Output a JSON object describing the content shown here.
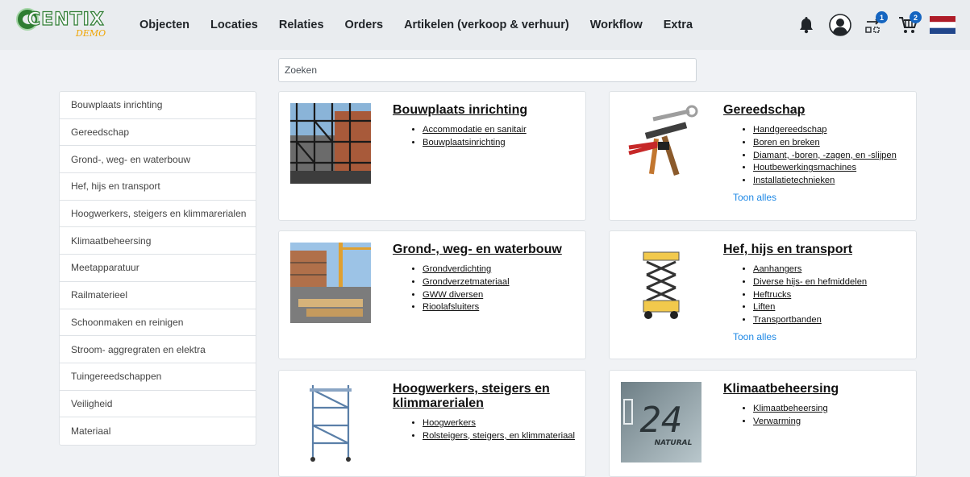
{
  "header": {
    "logo_text": "CENTIX",
    "logo_sub": "DEMO",
    "nav": [
      "Objecten",
      "Locaties",
      "Relaties",
      "Orders",
      "Artikelen (verkoop & verhuur)",
      "Workflow",
      "Extra"
    ],
    "icons": [
      "bell-icon",
      "user-avatar-icon",
      "transfer-icon",
      "cart-icon",
      "dutch-flag-icon"
    ],
    "transfer_count": "1",
    "cart_count": "2"
  },
  "search": {
    "placeholder": "Zoeken",
    "value": ""
  },
  "sidebar": {
    "items": [
      "Bouwplaats inrichting",
      "Gereedschap",
      "Grond-, weg- en waterbouw",
      "Hef, hijs en transport",
      "Hoogwerkers, steigers en klimmarerialen",
      "Klimaatbeheersing",
      "Meetapparatuur",
      "Railmaterieel",
      "Schoonmaken en reinigen",
      "Stroom- aggregraten en elektra",
      "Tuingereedschappen",
      "Veiligheid",
      "Materiaal"
    ]
  },
  "cards": [
    {
      "title": "Bouwplaats inrichting",
      "items": [
        "Accommodatie en sanitair",
        "Bouwplaatsinrichting"
      ]
    },
    {
      "title": "Gereedschap",
      "items": [
        "Handgereedschap",
        "Boren en breken",
        "Diamant, -boren, -zagen, en -slijpen",
        "Houtbewerkingsmachines",
        "Installatietechnieken"
      ],
      "more": "Toon alles"
    },
    {
      "title": "Grond-, weg- en waterbouw",
      "items": [
        "Grondverdichting",
        "Grondverzetmateriaal",
        "GWW diversen",
        "Rioolafsluiters"
      ]
    },
    {
      "title": "Hef, hijs en transport",
      "items": [
        "Aanhangers",
        "Diverse hijs- en hefmiddelen",
        "Heftrucks",
        "Liften",
        "Transportbanden"
      ],
      "more": "Toon alles"
    },
    {
      "title": "Hoogwerkers, steigers en klimmarerialen",
      "items": [
        "Hoogwerkers",
        "Rolsteigers, steigers, en klimmateriaal"
      ]
    },
    {
      "title": "Klimaatbeheersing",
      "items": [
        "Klimaatbeheersing",
        "Verwarming"
      ],
      "lcd_text": "24",
      "lcd_label": "NATURAL"
    }
  ],
  "colors": {
    "accent_link": "#1e88e5",
    "badge": "#1565c0",
    "logo_green": "#2e7d32",
    "logo_demo": "#f0a500"
  }
}
